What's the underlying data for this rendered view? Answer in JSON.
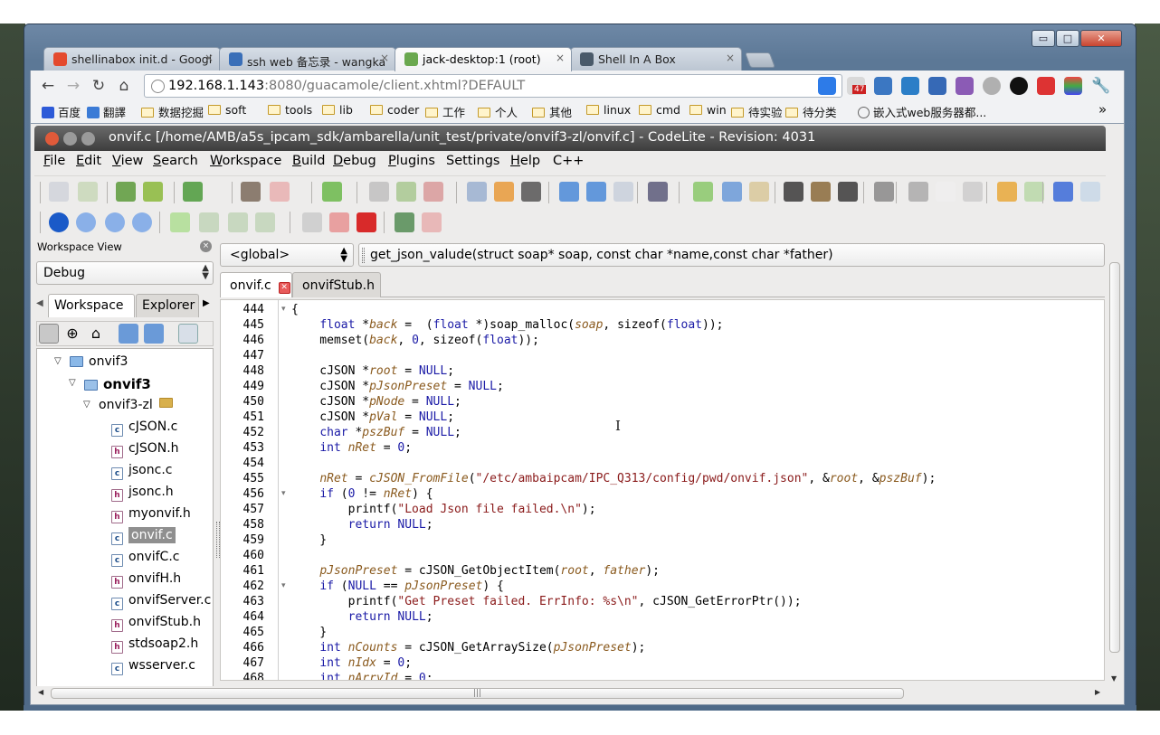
{
  "browser": {
    "tabs": [
      {
        "label": "shellinabox init.d - Googl",
        "fav_color": "#e44a2e",
        "close": "×"
      },
      {
        "label": "ssh web 备忘录 - wangka",
        "fav_color": "#3a6fb8",
        "close": "×"
      },
      {
        "label": "jack-desktop:1 (root)",
        "fav_color": "#6aa84f",
        "close": "×"
      },
      {
        "label": "Shell In A Box",
        "fav_color": "#4a5a6a",
        "close": "×"
      }
    ],
    "window_buttons": {
      "minimize": "▭",
      "maximize": "□",
      "close": "✕"
    },
    "url_host": "192.168.1.143",
    "url_rest": ":8080/guacamole/client.xhtml?DEFAULT",
    "extension_badges": {
      "gmail_count": "47"
    },
    "bookmarks": [
      {
        "label": "百度"
      },
      {
        "label": "翻譯"
      },
      {
        "label": "数据挖掘"
      },
      {
        "label": "soft"
      },
      {
        "label": "tools"
      },
      {
        "label": "lib"
      },
      {
        "label": "coder"
      },
      {
        "label": "工作"
      },
      {
        "label": "个人"
      },
      {
        "label": "其他"
      },
      {
        "label": "linux"
      },
      {
        "label": "cmd"
      },
      {
        "label": "win"
      },
      {
        "label": "待实验"
      },
      {
        "label": "待分类"
      },
      {
        "label": "嵌入式web服务器都..."
      }
    ],
    "bookmarks_overflow": "»"
  },
  "codelite": {
    "title": "onvif.c [/home/AMB/a5s_ipcam_sdk/ambarella/unit_test/private/onvif3-zl/onvif.c] - CodeLite - Revision: 4031",
    "menus": [
      {
        "u": "F",
        "rest": "ile"
      },
      {
        "u": "E",
        "rest": "dit"
      },
      {
        "u": "V",
        "rest": "iew"
      },
      {
        "u": "S",
        "rest": "earch"
      },
      {
        "u": "W",
        "rest": "orkspace"
      },
      {
        "u": "B",
        "rest": "uild"
      },
      {
        "u": "D",
        "rest": "ebug"
      },
      {
        "u": "P",
        "rest": "lugins"
      },
      {
        "u": "",
        "rest": "Settings"
      },
      {
        "u": "H",
        "rest": "elp"
      },
      {
        "u": "",
        "rest": "C++"
      }
    ],
    "workspace_view": {
      "title": "Workspace View",
      "close": "×",
      "config": "Debug",
      "tabs": [
        "Workspace",
        "Explorer"
      ],
      "tree": [
        {
          "label": "onvif3",
          "kind": "ws",
          "twist": "▽"
        },
        {
          "label": "onvif3",
          "kind": "proj",
          "twist": "▽"
        },
        {
          "label": "onvif3-zl",
          "kind": "fold",
          "twist": "▽"
        },
        {
          "label": "cJSON.c",
          "kind": "c"
        },
        {
          "label": "cJSON.h",
          "kind": "h"
        },
        {
          "label": "jsonc.c",
          "kind": "c"
        },
        {
          "label": "jsonc.h",
          "kind": "h"
        },
        {
          "label": "myonvif.h",
          "kind": "h"
        },
        {
          "label": "onvif.c",
          "kind": "c",
          "selected": true
        },
        {
          "label": "onvifC.c",
          "kind": "c"
        },
        {
          "label": "onvifH.h",
          "kind": "h"
        },
        {
          "label": "onvifServer.c",
          "kind": "c"
        },
        {
          "label": "onvifStub.h",
          "kind": "h"
        },
        {
          "label": "stdsoap2.h",
          "kind": "h"
        },
        {
          "label": "wsserver.c",
          "kind": "c"
        }
      ]
    },
    "scope": "<global>",
    "function": "get_json_valude(struct soap* soap, const char *name,const char *father)",
    "editor_tabs": [
      {
        "label": "onvif.c",
        "active": true
      },
      {
        "label": "onvifStub.h",
        "active": false
      }
    ],
    "code": [
      {
        "n": "444",
        "fold": "▾",
        "html": "{"
      },
      {
        "n": "445",
        "fold": "",
        "html": "    <span class='kw'>float</span> *<span class='vr'>back</span> =  (<span class='kw'>float</span> *)soap_malloc(<span class='vr'>soap</span>, sizeof(<span class='kw'>float</span>));"
      },
      {
        "n": "446",
        "fold": "",
        "html": "    memset(<span class='vr'>back</span>, <span class='nu'>0</span>, sizeof(<span class='kw'>float</span>));"
      },
      {
        "n": "447",
        "fold": "",
        "html": ""
      },
      {
        "n": "448",
        "fold": "",
        "html": "    cJSON *<span class='vr'>root</span> = <span class='kw'>NULL</span>;"
      },
      {
        "n": "449",
        "fold": "",
        "html": "    cJSON *<span class='vr'>pJsonPreset</span> = <span class='kw'>NULL</span>;"
      },
      {
        "n": "450",
        "fold": "",
        "html": "    cJSON *<span class='vr'>pNode</span> = <span class='kw'>NULL</span>;"
      },
      {
        "n": "451",
        "fold": "",
        "html": "    cJSON *<span class='vr'>pVal</span> = <span class='kw'>NULL</span>;"
      },
      {
        "n": "452",
        "fold": "",
        "html": "    <span class='kw'>char</span> *<span class='vr'>pszBuf</span> = <span class='kw'>NULL</span>;"
      },
      {
        "n": "453",
        "fold": "",
        "html": "    <span class='kw'>int</span> <span class='vr'>nRet</span> = <span class='nu'>0</span>;"
      },
      {
        "n": "454",
        "fold": "",
        "html": ""
      },
      {
        "n": "455",
        "fold": "",
        "html": "    <span class='vr'>nRet</span> = <span class='fn'>cJSON_FromFile</span>(<span class='st'>\"/etc/ambaipcam/IPC_Q313/config/pwd/onvif.json\"</span>, &amp;<span class='vr'>root</span>, &amp;<span class='vr'>pszBuf</span>);"
      },
      {
        "n": "456",
        "fold": "▾",
        "html": "    <span class='kw'>if</span> (<span class='nu'>0</span> != <span class='vr'>nRet</span>) {"
      },
      {
        "n": "457",
        "fold": "",
        "html": "        printf(<span class='st'>\"Load Json file failed.\\n\"</span>);"
      },
      {
        "n": "458",
        "fold": "",
        "html": "        <span class='kw'>return</span> <span class='kw'>NULL</span>;"
      },
      {
        "n": "459",
        "fold": "",
        "html": "    }"
      },
      {
        "n": "460",
        "fold": "",
        "html": ""
      },
      {
        "n": "461",
        "fold": "",
        "html": "    <span class='vr'>pJsonPreset</span> = cJSON_GetObjectItem(<span class='vr'>root</span>, <span class='vr'>father</span>);"
      },
      {
        "n": "462",
        "fold": "▾",
        "html": "    <span class='kw'>if</span> (<span class='kw'>NULL</span> == <span class='vr'>pJsonPreset</span>) {"
      },
      {
        "n": "463",
        "fold": "",
        "html": "        printf(<span class='st'>\"Get Preset failed. ErrInfo: %s\\n\"</span>, cJSON_GetErrorPtr());"
      },
      {
        "n": "464",
        "fold": "",
        "html": "        <span class='kw'>return</span> <span class='kw'>NULL</span>;"
      },
      {
        "n": "465",
        "fold": "",
        "html": "    }"
      },
      {
        "n": "466",
        "fold": "",
        "html": "    <span class='kw'>int</span> <span class='vr'>nCounts</span> = cJSON_GetArraySize(<span class='vr'>pJsonPreset</span>);"
      },
      {
        "n": "467",
        "fold": "",
        "html": "    <span class='kw'>int</span> <span class='vr'>nIdx</span> = <span class='nu'>0</span>;"
      },
      {
        "n": "468",
        "fold": "",
        "html": "    <span class='kw'>int</span> <span class='vr'>nArryId</span> = <span class='nu'>0</span>;"
      }
    ]
  }
}
